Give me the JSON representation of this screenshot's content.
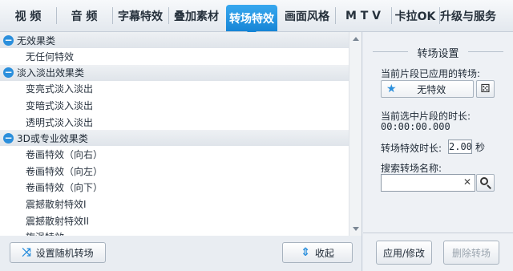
{
  "tabs": [
    {
      "label": "视 频",
      "active": false
    },
    {
      "label": "音 频",
      "active": false
    },
    {
      "label": "字幕特效",
      "active": false
    },
    {
      "label": "叠加素材",
      "active": false
    },
    {
      "label": "转场特效",
      "active": true
    },
    {
      "label": "画面风格",
      "active": false
    },
    {
      "label": "M T V",
      "active": false
    },
    {
      "label": "卡拉OK",
      "active": false
    },
    {
      "label": "升级与服务",
      "active": false
    }
  ],
  "effects": {
    "groups": [
      {
        "title": "无效果类",
        "items": [
          "无任何特效"
        ]
      },
      {
        "title": "淡入淡出效果类",
        "items": [
          "变亮式淡入淡出",
          "变暗式淡入淡出",
          "透明式淡入淡出"
        ]
      },
      {
        "title": "3D或专业效果类",
        "items": [
          "卷画特效（向右）",
          "卷画特效（向左）",
          "卷画特效（向下）",
          "震撼散射特效I",
          "震撼散射特效II",
          "旋涡特效"
        ]
      }
    ]
  },
  "bottom": {
    "random_button": "设置随机转场",
    "collapse_button": "收起"
  },
  "settings": {
    "title": "转场设置",
    "applied_label": "当前片段已应用的转场:",
    "applied_value": "无特效",
    "clip_duration_label": "当前选中片段的时长:",
    "clip_duration_value": "00:00:00.000",
    "effect_duration_label": "转场特效时长:",
    "effect_duration_value": "2.00",
    "effect_duration_unit": "秒",
    "search_label": "搜索转场名称:",
    "search_value": "",
    "apply_button": "应用/修改",
    "delete_button": "删除转场"
  },
  "colors": {
    "accent": "#1685d6",
    "tab_active": "#38a8ef"
  }
}
